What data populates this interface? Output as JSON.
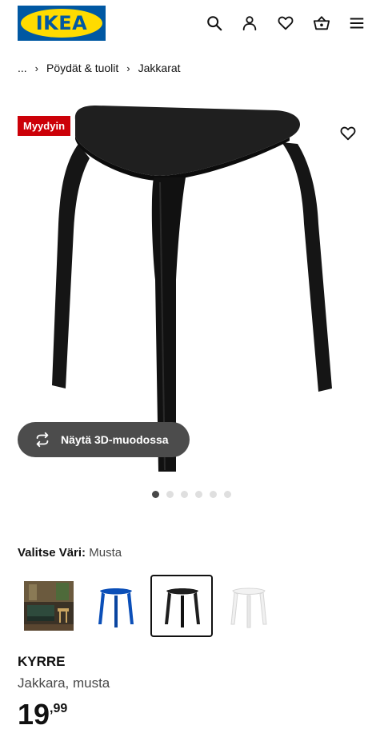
{
  "header": {
    "logo_text": "IKEA",
    "icons": [
      "search-icon",
      "profile-icon",
      "heart-icon",
      "basket-icon",
      "menu-icon"
    ]
  },
  "breadcrumb": {
    "items": [
      "...",
      "Pöydät & tuolit",
      "Jakkarat"
    ]
  },
  "gallery": {
    "badge": "Myydyin",
    "button_3d_label": "Näytä 3D-muodossa",
    "dot_count": 6,
    "active_dot": 0
  },
  "color_selector": {
    "label": "Valitse Väri:",
    "value": "Musta",
    "swatches": [
      {
        "name": "room",
        "selected": false
      },
      {
        "name": "blue",
        "color": "#0b4fb8",
        "selected": false
      },
      {
        "name": "black",
        "color": "#1e1e1e",
        "selected": true
      },
      {
        "name": "white",
        "color": "#f2f2f2",
        "selected": false
      }
    ]
  },
  "product": {
    "name": "KYRRE",
    "description": "Jakkara, musta",
    "price_int": "19",
    "price_dec": ",99"
  },
  "colors": {
    "brand_blue": "#0058a3",
    "brand_yellow": "#ffdb00",
    "badge_red": "#cc0008",
    "dark_button": "#4c4c4c"
  }
}
